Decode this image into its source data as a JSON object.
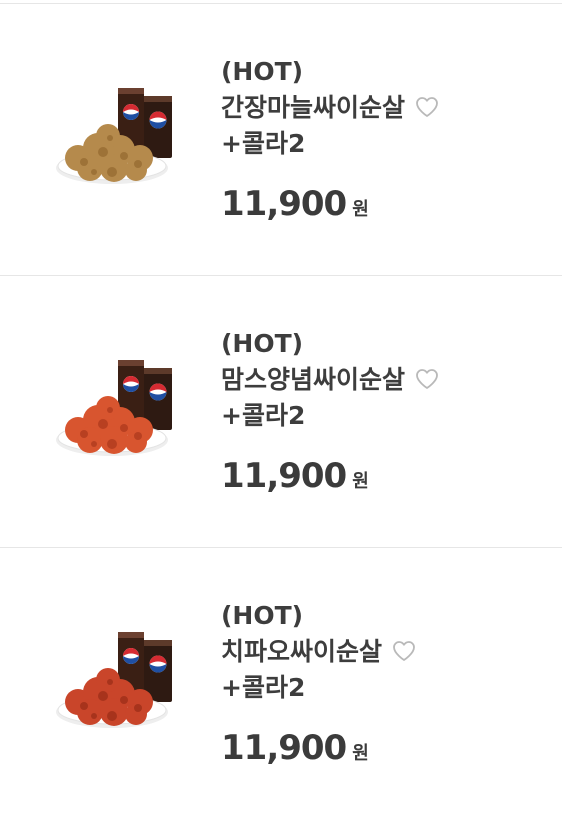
{
  "products": [
    {
      "name_line1": "(HOT)",
      "name_line2": "간장마늘싸이순살",
      "name_line3": "+콜라2",
      "price": "11,900",
      "currency": "원",
      "chicken_color": "#b58a4c",
      "chicken_shade": "#8a5f27",
      "favorite_icon": "heart-outline-icon",
      "cup_brand": "PEPSI"
    },
    {
      "name_line1": "(HOT)",
      "name_line2": "맘스양념싸이순살",
      "name_line3": "+콜라2",
      "price": "11,900",
      "currency": "원",
      "chicken_color": "#d8552f",
      "chicken_shade": "#9e2f16",
      "favorite_icon": "heart-outline-icon",
      "cup_brand": "PEPSI"
    },
    {
      "name_line1": "(HOT)",
      "name_line2": "치파오싸이순살",
      "name_line3": "+콜라2",
      "price": "11,900",
      "currency": "원",
      "chicken_color": "#c9452a",
      "chicken_shade": "#8c2612",
      "favorite_icon": "heart-outline-icon",
      "cup_brand": "PEPSI"
    }
  ]
}
